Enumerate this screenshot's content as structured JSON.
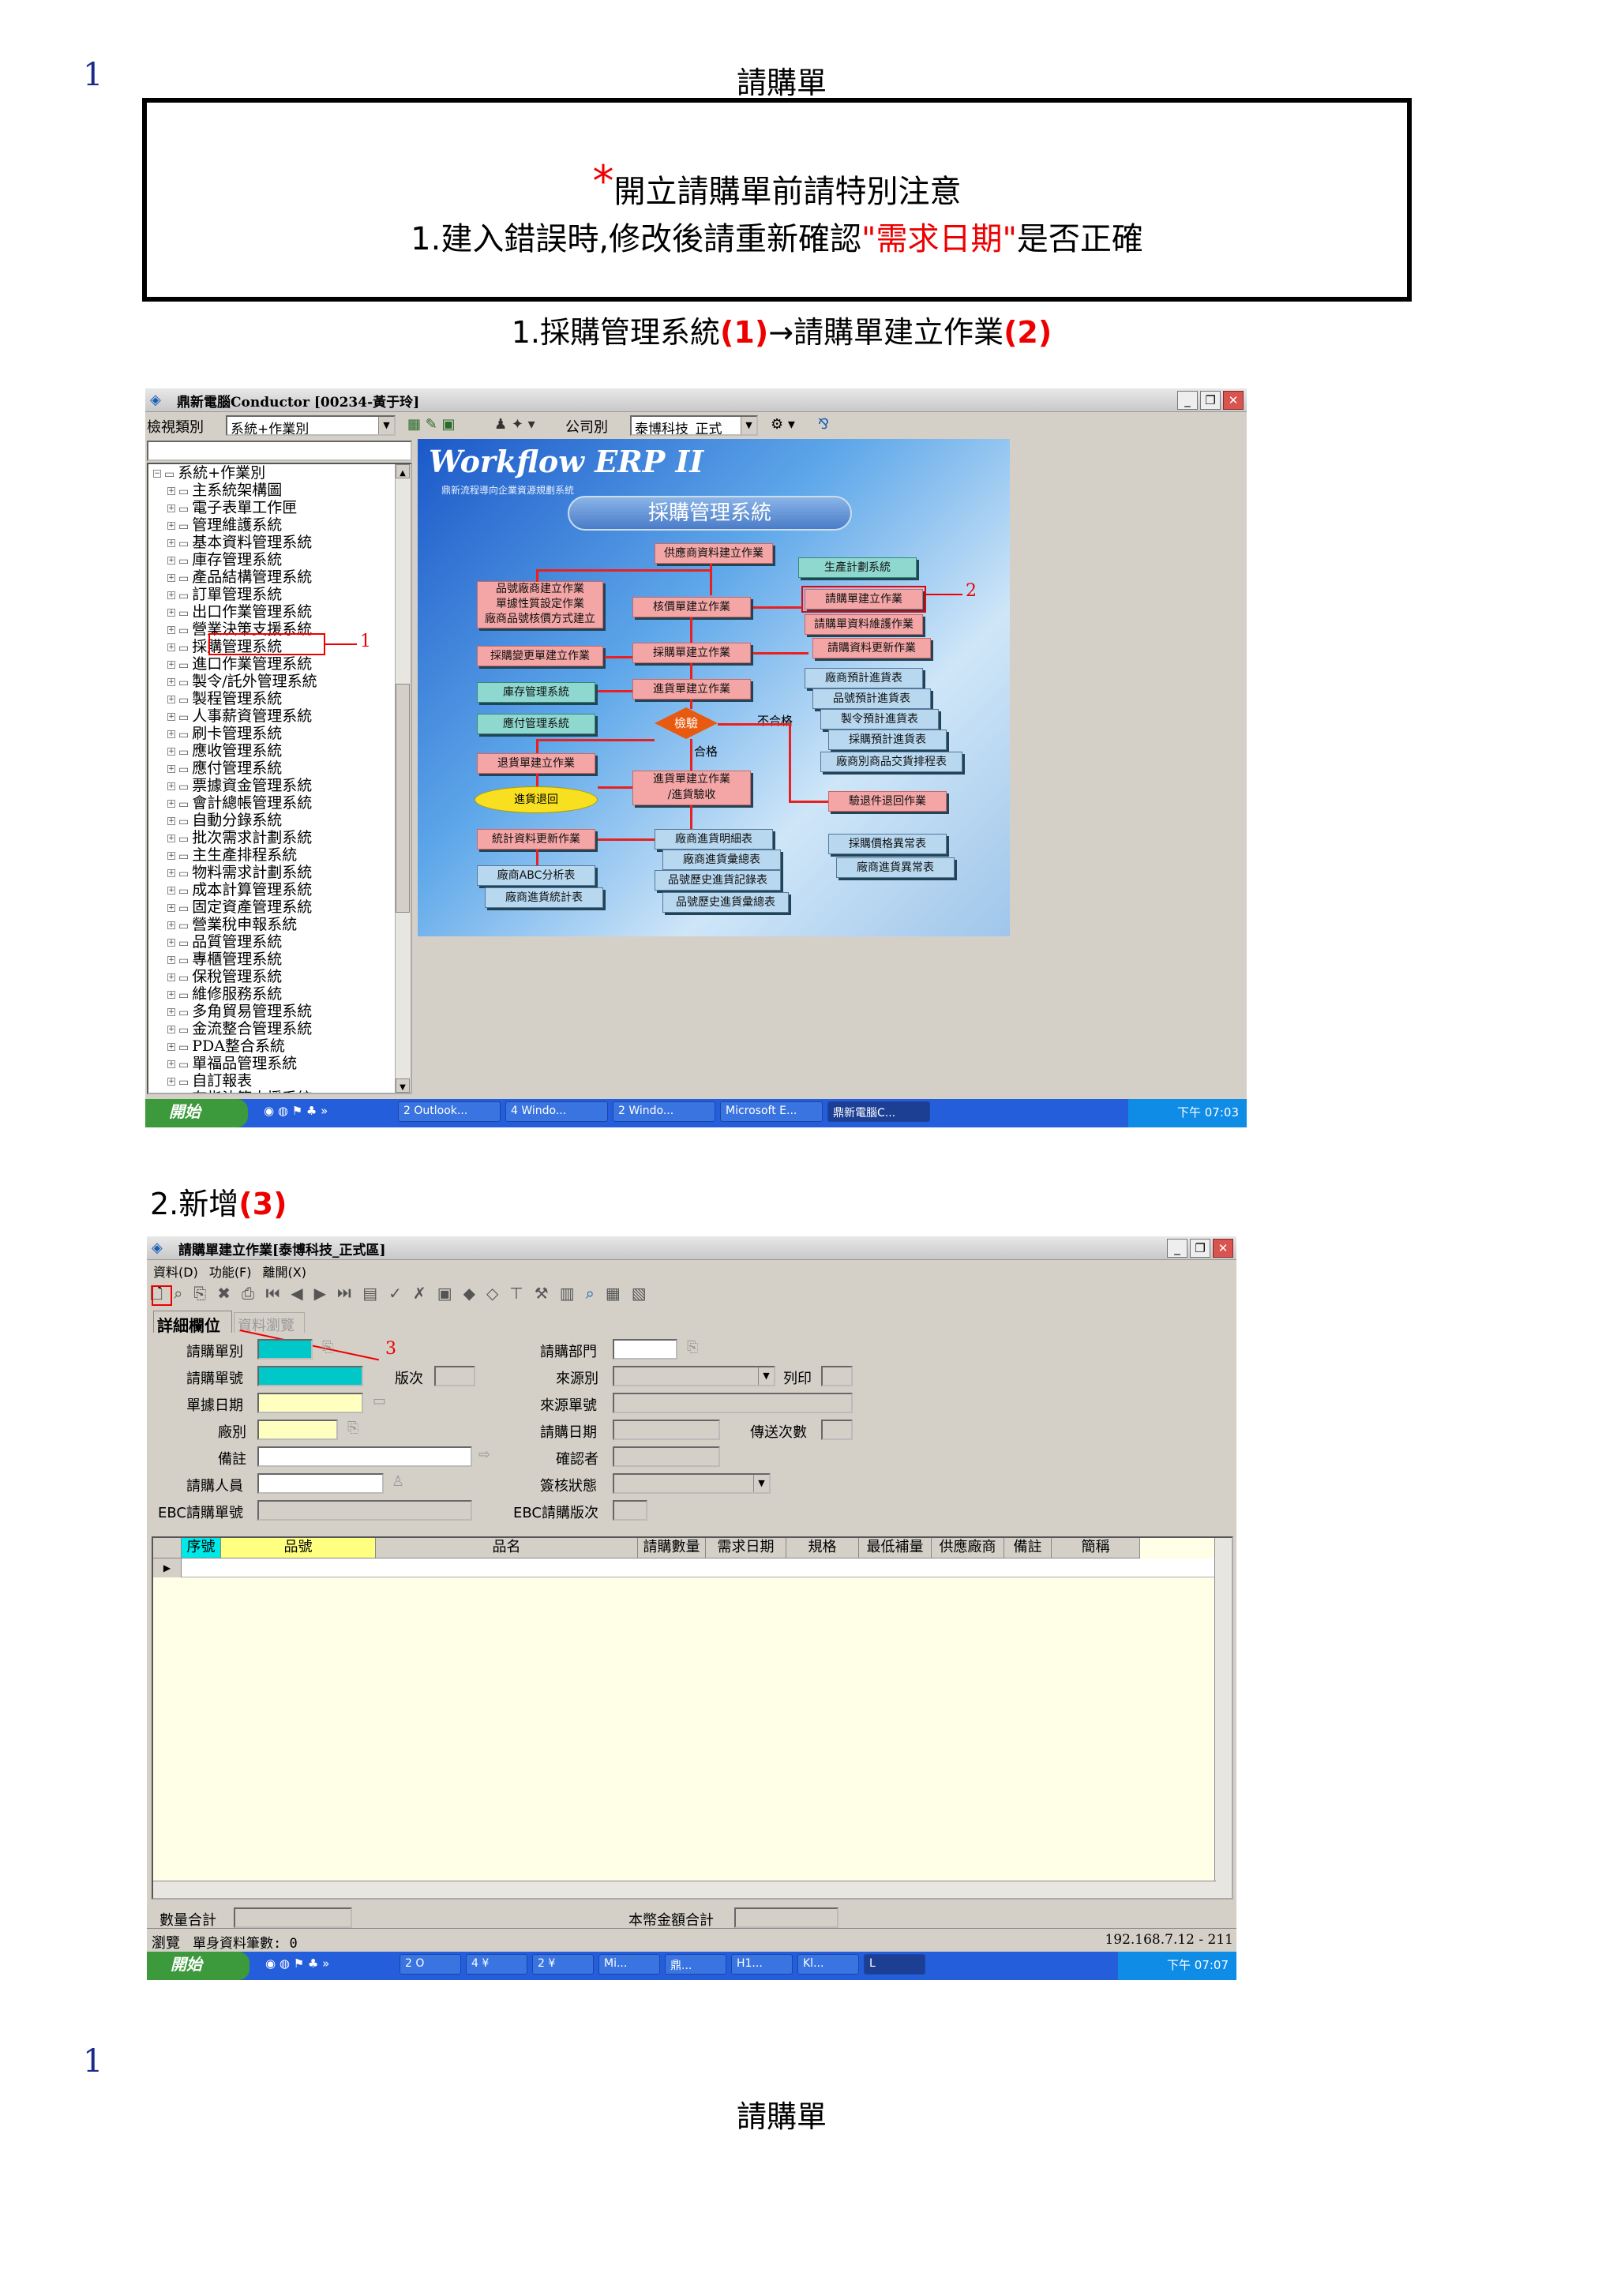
{
  "page_number_top": "1",
  "page_title_top": "請購單",
  "notice": {
    "star": "*",
    "line1": "開立請購單前請特別注意",
    "line2_prefix": "1.建入錯誤時,修改後請重新確認",
    "line2_highlight": "\"需求日期\"",
    "line2_suffix": "是否正確"
  },
  "step1": {
    "text_a": "1.採購管理系統",
    "mark_a": "(1)",
    "arrow": "→",
    "text_b": "請購單建立作業",
    "mark_b": "(2)"
  },
  "window1": {
    "title": "鼎新電腦Conductor [00234-黃于玲]",
    "view_label": "檢視類別",
    "view_value": "系統+作業別",
    "company_label": "公司別",
    "company_value": "泰博科技_正式",
    "tree_root": "系統+作業別",
    "tree_items": [
      "主系統架構圖",
      "電子表單工作匣",
      "管理維護系統",
      "基本資料管理系統",
      "庫存管理系統",
      "產品結構管理系統",
      "訂單管理系統",
      "出口作業管理系統",
      "營業決策支援系統",
      "採購管理系統",
      "進口作業管理系統",
      "製令/託外管理系統",
      "製程管理系統",
      "人事薪資管理系統",
      "刷卡管理系統",
      "應收管理系統",
      "應付管理系統",
      "票據資金管理系統",
      "會計總帳管理系統",
      "自動分錄系統",
      "批次需求計劃系統",
      "主生產排程系統",
      "物料需求計劃系統",
      "成本計算管理系統",
      "固定資產管理系統",
      "營業稅申報系統",
      "品質管理系統",
      "專櫃管理系統",
      "保稅管理系統",
      "維修服務系統",
      "多角貿易管理系統",
      "金流整合管理系統",
      "PDA整合系統",
      "單福品管理系統",
      "自訂報表",
      "有指決策支援系統"
    ],
    "marker1": "1",
    "marker2": "2",
    "erp_logo": "Workflow ERP II",
    "erp_subtitle": "鼎新流程導向企業資源規劃系統",
    "erp_banner": "採購管理系統",
    "flow_boxes": {
      "supplier": "供應商資料建立作業",
      "production": "生產計劃系統",
      "item_supplier": "品號廠商建立作業",
      "doc_prop": "單據性質設定作業",
      "supplier_price": "廠商品號核價方式建立",
      "approve_price": "核價單建立作業",
      "requisition": "請購單建立作業",
      "req_maintain": "請購單資料維護作業",
      "req_update": "請購資料更新作業",
      "po_change": "採購變更單建立作業",
      "po": "採購單建立作業",
      "inventory": "庫存管理系統",
      "payable": "應付管理系統",
      "receipt": "進貨單建立作業",
      "vendor_plan": "廠商預計進貨表",
      "item_plan": "品號預計進貨表",
      "mo_plan": "製令預計進貨表",
      "po_plan": "採購預計進貨表",
      "vendor_rank": "廠商別商品交貨排程表",
      "inspect": "檢驗",
      "fail": "不合格",
      "pass": "合格",
      "return": "退貨單建立作業",
      "return_ret": "進貨退回",
      "receipt_inspect": "進貨單建立作業\n/進貨驗收",
      "rework": "驗退件退回作業",
      "stat_update": "統計資料更新作業",
      "vendor_detail": "廠商進貨明細表",
      "vendor_summary": "廠商進貨彙總表",
      "abc": "廠商ABC分析表",
      "price_abn": "採購價格異常表",
      "vendor_stat": "廠商進貨統計表",
      "item_hist": "品號歷史進貨記錄表",
      "vendor_abn": "廠商進貨異常表",
      "item_hist_sum": "品號歷史進貨彙總表"
    },
    "taskbar": {
      "start": "開始",
      "items": [
        "2 Outlook...",
        "4 Windo...",
        "2 Windo...",
        "Microsoft E...",
        "鼎新電腦C..."
      ],
      "clock": "下午 07:03"
    }
  },
  "step2": {
    "text": "2.新增",
    "mark": "(3)"
  },
  "window2": {
    "title": "請購單建立作業[泰博科技_正式區]",
    "menu": [
      "資料(D)",
      "功能(F)",
      "離開(X)"
    ],
    "tab_detail": "詳細欄位",
    "tab_browse": "資料瀏覽",
    "marker3": "3",
    "fields": {
      "req_type": "請購單別",
      "req_no": "請購單號",
      "version": "版次",
      "doc_date": "單據日期",
      "factory": "廠別",
      "remark": "備註",
      "requester": "請購人員",
      "ebc_no": "EBC請購單號",
      "dept": "請購部門",
      "source_type": "來源別",
      "print": "列印",
      "source_no": "來源單號",
      "req_date": "請購日期",
      "send_count": "傳送次數",
      "confirmer": "確認者",
      "approval": "簽核狀態",
      "ebc_version": "EBC請購版次"
    },
    "grid_headers": [
      "序號",
      "品號",
      "品名",
      "請購數量",
      "需求日期",
      "規格",
      "最低補量",
      "供應廠商",
      "備註",
      "簡稱"
    ],
    "qty_total": "數量合計",
    "amount_total": "本幣金額合計",
    "status_browse": "瀏覽",
    "status_count": "單身資料筆數: 0",
    "status_ip": "192.168.7.12 - 211",
    "taskbar": {
      "start": "開始",
      "items": [
        "2 O",
        "4 ¥",
        "2 ¥",
        "Mi...",
        "鼎...",
        "H1...",
        "Kl...",
        "L"
      ],
      "clock": "下午 07:07"
    }
  },
  "page_number_bottom": "1",
  "page_title_bottom": "請購單"
}
